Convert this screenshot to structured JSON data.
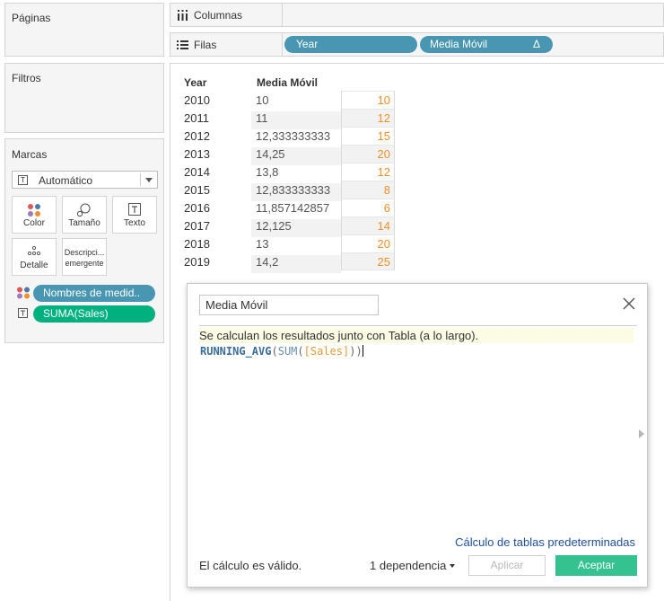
{
  "cards": {
    "pages": {
      "title": "Páginas"
    },
    "filters": {
      "title": "Filtros"
    },
    "marks": {
      "title": "Marcas",
      "type": "Automático",
      "buttons": {
        "color": "Color",
        "size": "Tamaño",
        "text": "Texto",
        "detail": "Detalle",
        "tooltip_line1": "Descripci...",
        "tooltip_line2": "emergente"
      },
      "pills": [
        {
          "label": "Nombres de medid.."
        },
        {
          "label": "SUMA(Sales)"
        }
      ]
    }
  },
  "shelves": {
    "columns": {
      "label": "Columnas"
    },
    "rows": {
      "label": "Filas",
      "pills": [
        {
          "label": "Year"
        },
        {
          "label": "Media Móvil"
        }
      ],
      "delta_symbol": "Δ"
    }
  },
  "table": {
    "headers": {
      "year": "Year",
      "avg": "Media Móvil"
    },
    "rows": [
      {
        "year": "2010",
        "avg": "10",
        "sum": "10"
      },
      {
        "year": "2011",
        "avg": "11",
        "sum": "12"
      },
      {
        "year": "2012",
        "avg": "12,333333333",
        "sum": "15"
      },
      {
        "year": "2013",
        "avg": "14,25",
        "sum": "20"
      },
      {
        "year": "2014",
        "avg": "13,8",
        "sum": "12"
      },
      {
        "year": "2015",
        "avg": "12,833333333",
        "sum": "8"
      },
      {
        "year": "2016",
        "avg": "11,857142857",
        "sum": "6"
      },
      {
        "year": "2017",
        "avg": "12,125",
        "sum": "14"
      },
      {
        "year": "2018",
        "avg": "13",
        "sum": "20"
      },
      {
        "year": "2019",
        "avg": "14,2",
        "sum": "25"
      }
    ]
  },
  "dialog": {
    "name_value": "Media Móvil",
    "hint": "Se calculan los resultados junto con Tabla (a lo largo).",
    "code": {
      "fn_outer": "RUNNING_AVG",
      "open1": "(",
      "fn_inner": "SUM",
      "open2": "(",
      "field": "[Sales]",
      "close": "))"
    },
    "default_link": "Cálculo de tablas predeterminadas",
    "status": "El cálculo es válido.",
    "dependency": "1 dependencia",
    "apply": "Aplicar",
    "ok": "Aceptar"
  },
  "colors": {
    "pill_blue": "#4996b2",
    "pill_green": "#00b180",
    "measure_orange": "#f28e2b",
    "ok_button": "#35c291"
  }
}
